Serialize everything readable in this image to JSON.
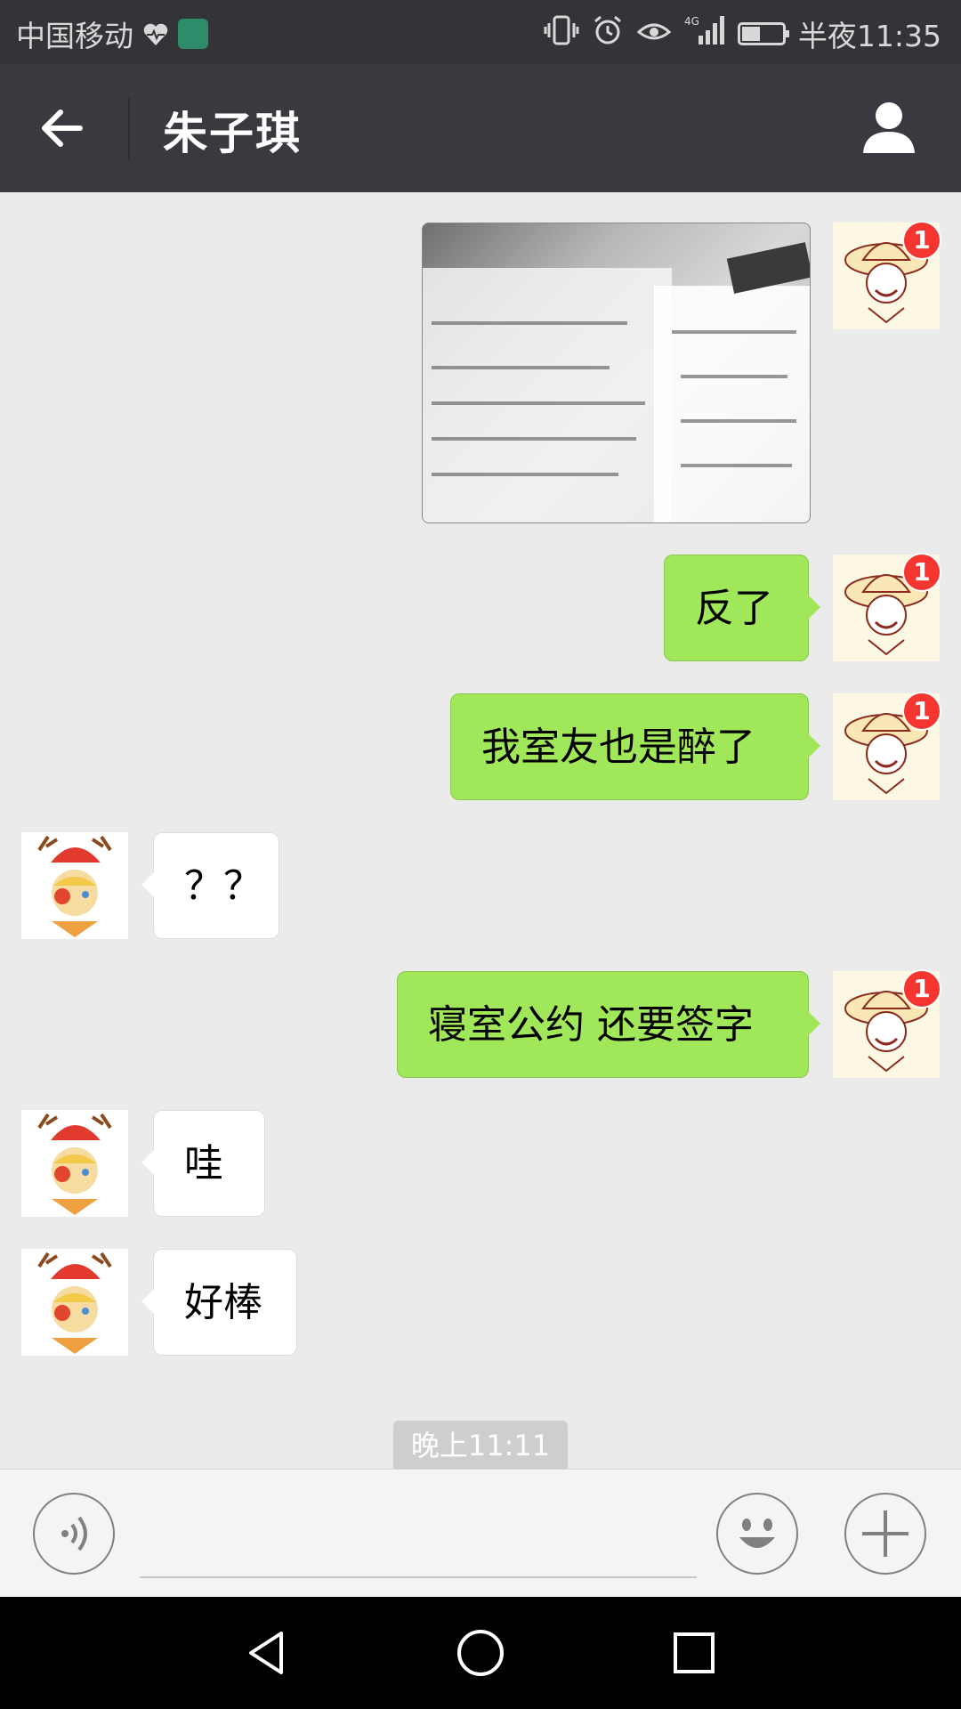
{
  "status_bar": {
    "carrier": "中国移动",
    "time": "半夜11:35",
    "network": "4G",
    "icons": [
      "heartbeat-icon",
      "app-notification-icon",
      "vibrate-icon",
      "alarm-icon",
      "eye-icon",
      "signal-icon",
      "battery-icon"
    ]
  },
  "header": {
    "title": "朱子琪",
    "back_icon": "arrow-left-icon",
    "profile_icon": "person-icon"
  },
  "messages": [
    {
      "sender": "me",
      "type": "image",
      "unread_badge": "1"
    },
    {
      "sender": "me",
      "type": "text",
      "text": "反了",
      "unread_badge": "1"
    },
    {
      "sender": "me",
      "type": "text",
      "text": "我室友也是醉了",
      "unread_badge": "1"
    },
    {
      "sender": "other",
      "type": "text",
      "text": "？？"
    },
    {
      "sender": "me",
      "type": "text",
      "text": "寝室公约 还要签字",
      "unread_badge": "1"
    },
    {
      "sender": "other",
      "type": "text",
      "text": "哇"
    },
    {
      "sender": "other",
      "type": "text",
      "text": "好棒"
    }
  ],
  "timestamp": "晚上11:11",
  "input_bar": {
    "voice_icon": "voice-icon",
    "emoji_icon": "smiley-icon",
    "plus_icon": "plus-icon",
    "text_value": ""
  },
  "nav_bar": {
    "icons": [
      "nav-back-icon",
      "nav-home-icon",
      "nav-recents-icon"
    ]
  },
  "colors": {
    "header_bg": "#393a3f",
    "chat_bg": "#ebebeb",
    "my_bubble": "#a0e75a",
    "other_bubble": "#ffffff",
    "badge": "#f43530"
  }
}
